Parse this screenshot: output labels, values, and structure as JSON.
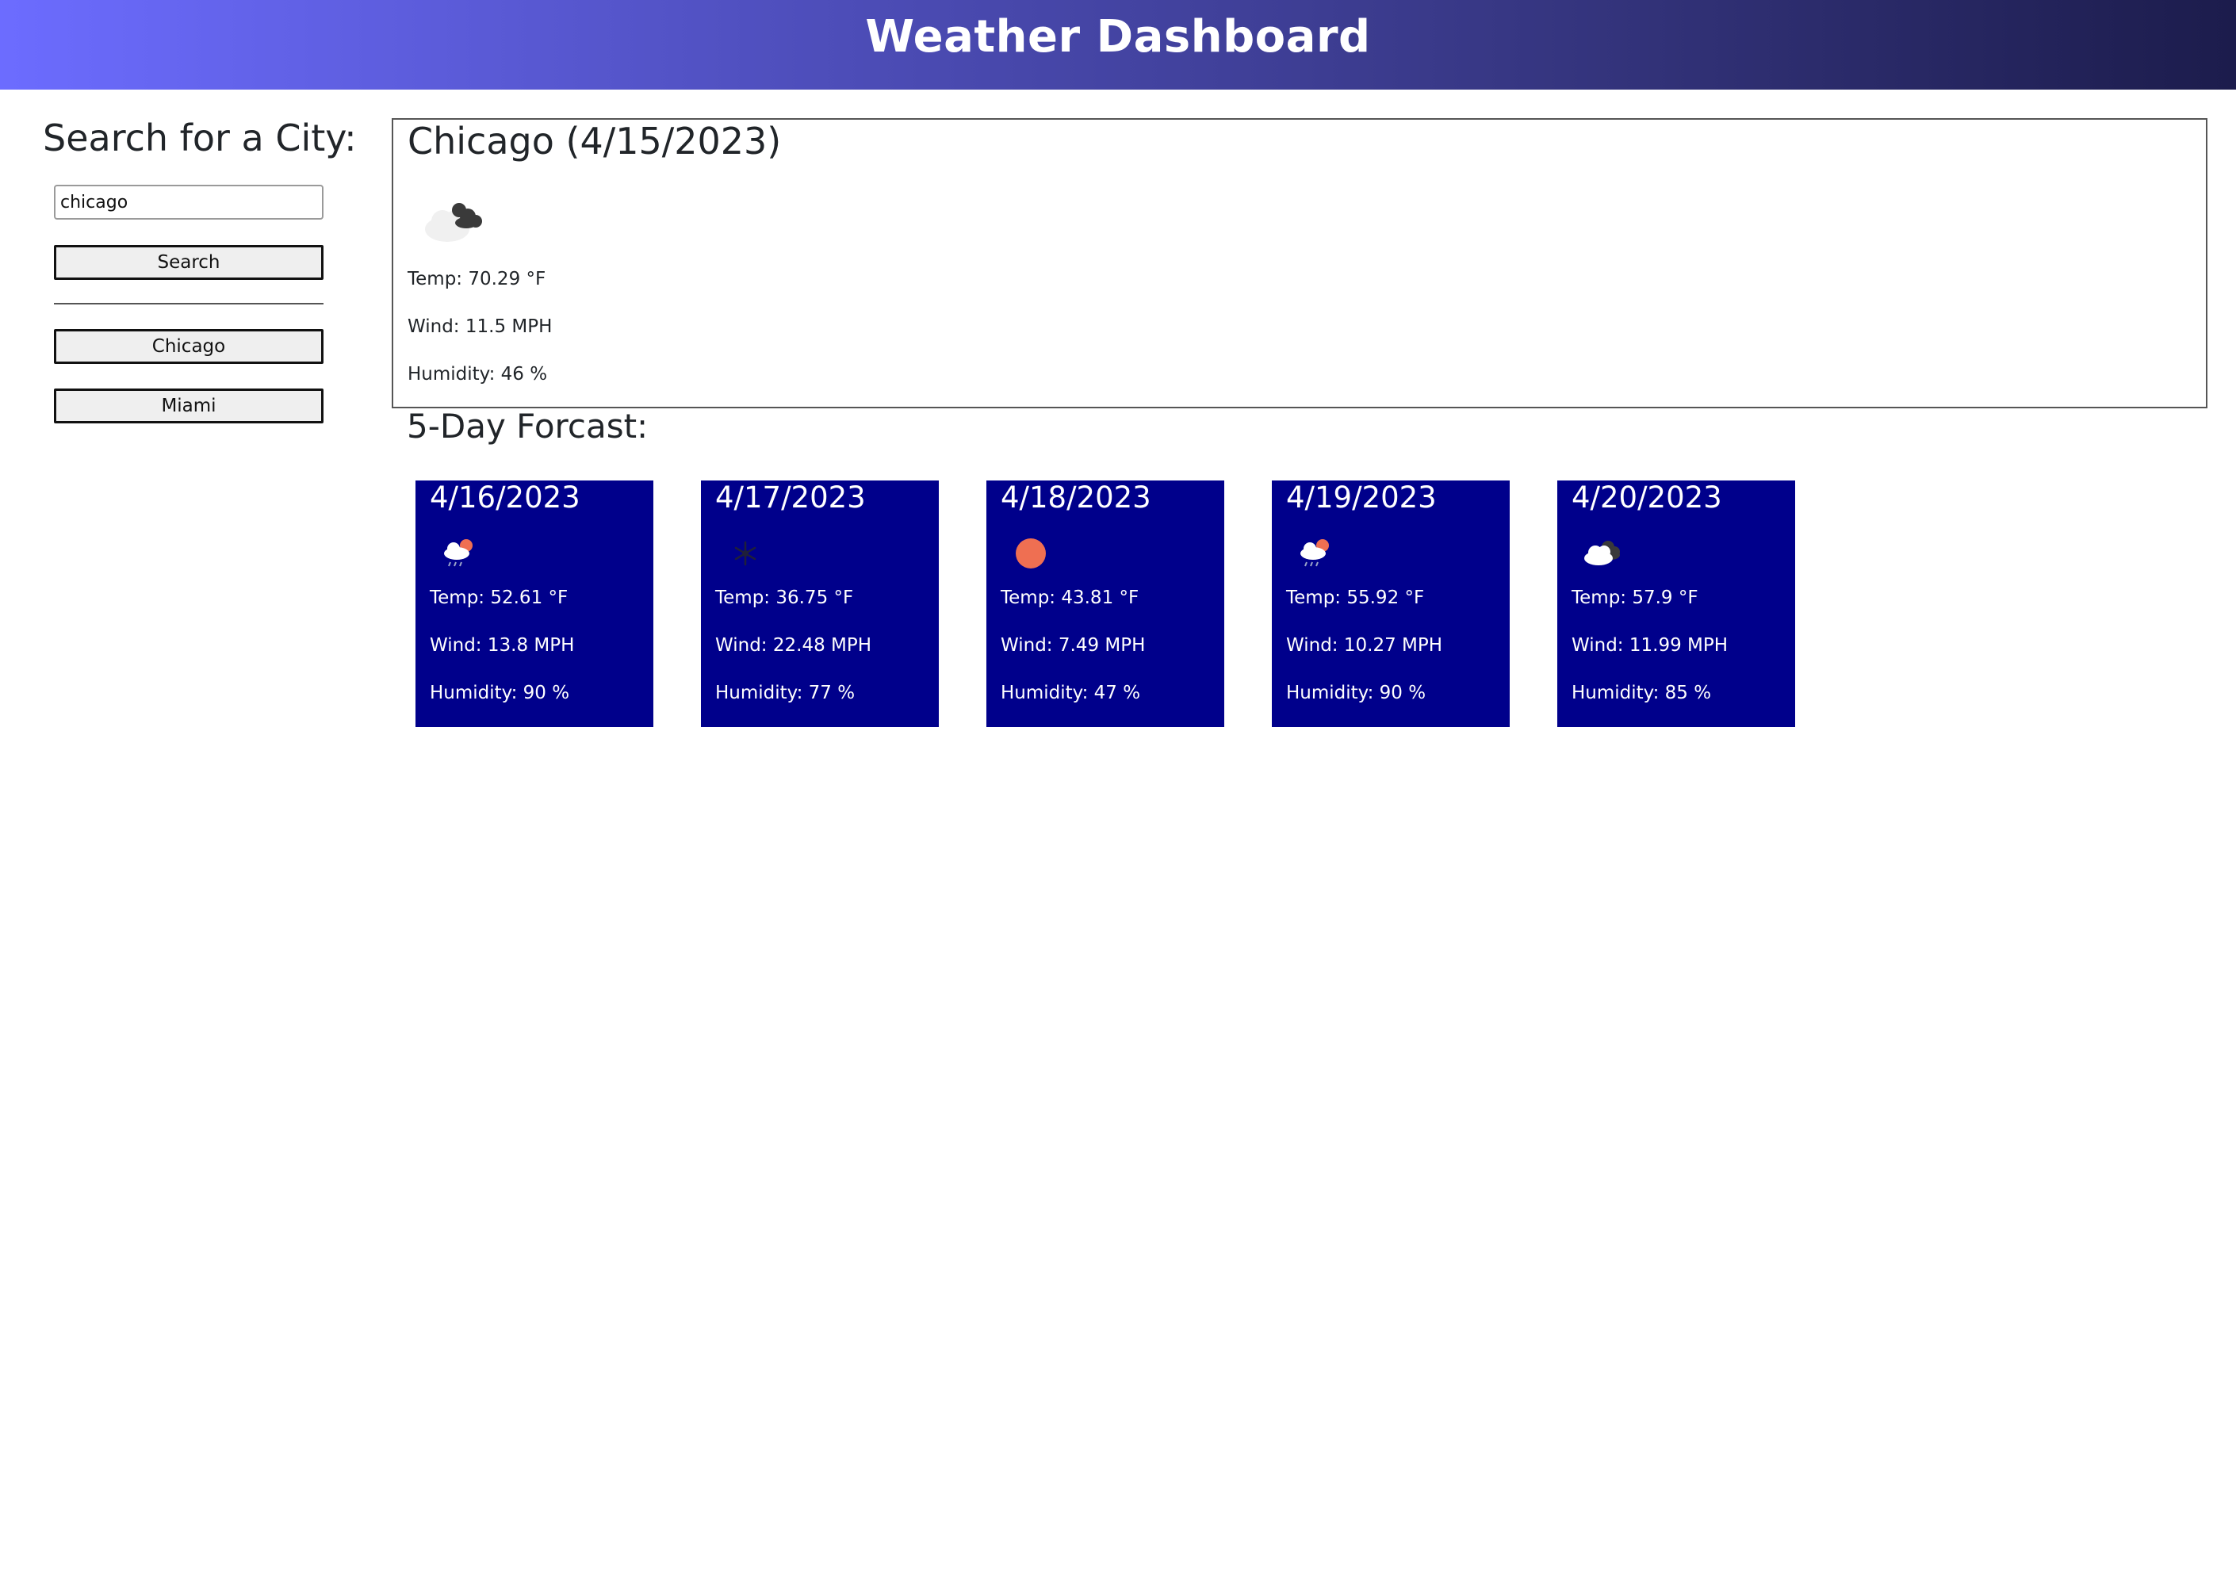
{
  "header": {
    "title": "Weather Dashboard"
  },
  "sidebar": {
    "title": "Search for a City:",
    "search_value": "chicago",
    "search_button": "Search",
    "history": [
      "Chicago",
      "Miami"
    ]
  },
  "current": {
    "title": "Chicago (4/15/2023)",
    "icon": "broken-clouds-icon",
    "temp": "Temp: 70.29 °F",
    "wind": "Wind: 11.5 MPH",
    "humidity": "Humidity: 46 %"
  },
  "forecast": {
    "title": "5-Day Forcast:",
    "days": [
      {
        "date": "4/16/2023",
        "icon": "rain-icon",
        "temp": "Temp: 52.61 °F",
        "wind": "Wind: 13.8 MPH",
        "humidity": "Humidity: 90 %"
      },
      {
        "date": "4/17/2023",
        "icon": "snow-icon",
        "temp": "Temp: 36.75 °F",
        "wind": "Wind: 22.48 MPH",
        "humidity": "Humidity: 77 %"
      },
      {
        "date": "4/18/2023",
        "icon": "clear-sky-icon",
        "temp": "Temp: 43.81 °F",
        "wind": "Wind: 7.49 MPH",
        "humidity": "Humidity: 47 %"
      },
      {
        "date": "4/19/2023",
        "icon": "rain-icon",
        "temp": "Temp: 55.92 °F",
        "wind": "Wind: 10.27 MPH",
        "humidity": "Humidity: 90 %"
      },
      {
        "date": "4/20/2023",
        "icon": "broken-clouds-icon",
        "temp": "Temp: 57.9 °F",
        "wind": "Wind: 11.99 MPH",
        "humidity": "Humidity: 85 %"
      }
    ]
  },
  "colors": {
    "card_bg": "#00008b",
    "header_gradient_start": "#6c6cff",
    "header_gradient_end": "#1c1c4c"
  }
}
